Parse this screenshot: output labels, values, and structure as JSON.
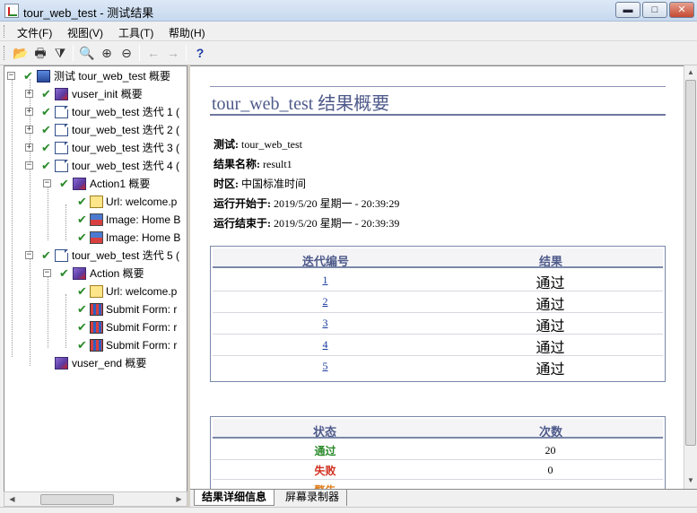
{
  "window": {
    "title": "tour_web_test - 测试结果",
    "buttons": {
      "minimize": "▬",
      "maximize": "□",
      "close": "✕"
    }
  },
  "menu": [
    "文件(F)",
    "视图(V)",
    "工具(T)",
    "帮助(H)"
  ],
  "toolbar": {
    "icons": [
      "open-folder-icon",
      "print-icon",
      "filter-icon",
      "find-icon",
      "zoom-in-icon",
      "zoom-out-icon",
      "back-icon",
      "forward-icon",
      "help-icon"
    ],
    "glyphs": [
      "📂",
      "🖶",
      "⧩",
      "🔍",
      "⊕",
      "⊖",
      "←",
      "→",
      "?"
    ]
  },
  "tree": {
    "root": "测试 tour_web_test 概要",
    "items": [
      {
        "label": "vuser_init 概要"
      },
      {
        "label": "tour_web_test 迭代 1 ("
      },
      {
        "label": "tour_web_test 迭代 2 ("
      },
      {
        "label": "tour_web_test 迭代 3 ("
      },
      {
        "label": "tour_web_test 迭代 4 ("
      },
      {
        "label": "Action1 概要"
      },
      {
        "label": "Url: welcome.p"
      },
      {
        "label": "Image: Home B"
      },
      {
        "label": "Image: Home B"
      },
      {
        "label": "tour_web_test 迭代 5 ("
      },
      {
        "label": "Action 概要"
      },
      {
        "label": "Url: welcome.p"
      },
      {
        "label": "Submit Form: r"
      },
      {
        "label": "Submit Form: r"
      },
      {
        "label": "Submit Form: r"
      },
      {
        "label": "vuser_end 概要"
      }
    ]
  },
  "summary": {
    "heading": "tour_web_test 结果概要",
    "test_label": "测试:",
    "test_value": "tour_web_test",
    "result_name_label": "结果名称:",
    "result_name_value": "result1",
    "timezone_label": "时区:",
    "timezone_value": "中国标准时间",
    "start_label": "运行开始于:",
    "start_value": "2019/5/20 星期一  - 20:39:29",
    "end_label": "运行结束于:",
    "end_value": "2019/5/20 星期一  - 20:39:39"
  },
  "iterations_table": {
    "headers": [
      "迭代编号",
      "结果"
    ],
    "rows": [
      {
        "num": "1",
        "result": "通过"
      },
      {
        "num": "2",
        "result": "通过"
      },
      {
        "num": "3",
        "result": "通过"
      },
      {
        "num": "4",
        "result": "通过"
      },
      {
        "num": "5",
        "result": "通过"
      }
    ]
  },
  "status_table": {
    "headers": [
      "状态",
      "次数"
    ],
    "rows": [
      {
        "status": "通过",
        "count": "20",
        "color": "#2a8a2a"
      },
      {
        "status": "失败",
        "count": "0",
        "color": "#d03020"
      },
      {
        "status": "警告",
        "count": "",
        "color": "#e08020"
      }
    ]
  },
  "tabs": [
    "结果详细信息",
    "屏幕录制器"
  ]
}
